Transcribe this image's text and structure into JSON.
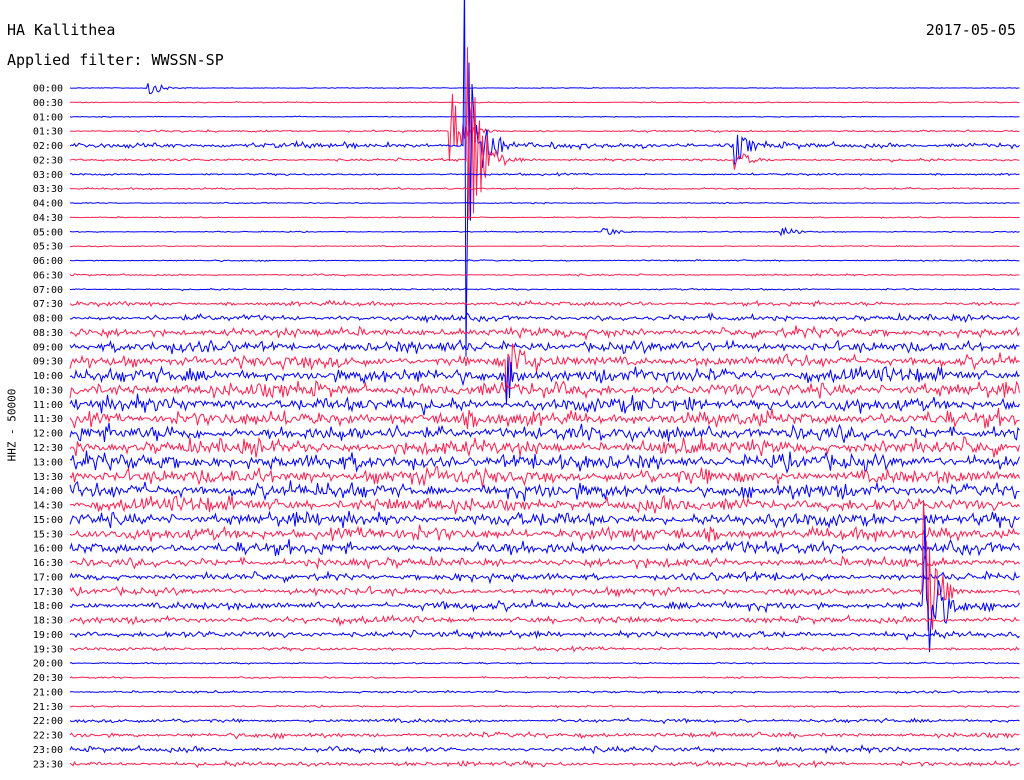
{
  "header": {
    "station": "HA Kallithea",
    "date": "2017-05-05",
    "filter": "Applied filter: WWSSN-SP"
  },
  "chart_data": {
    "type": "line",
    "title": "HA Kallithea",
    "ylabel": "HHZ - 50000",
    "colors": [
      "#0000ff",
      "#ff1f4f"
    ],
    "tick_labels": [
      "00:00",
      "00:30",
      "01:00",
      "01:30",
      "02:00",
      "02:30",
      "03:00",
      "03:30",
      "04:00",
      "04:30",
      "05:00",
      "05:30",
      "06:00",
      "06:30",
      "07:00",
      "07:30",
      "08:00",
      "08:30",
      "09:00",
      "09:30",
      "10:00",
      "10:30",
      "11:00",
      "11:30",
      "12:00",
      "12:30",
      "13:00",
      "13:30",
      "14:00",
      "14:30",
      "15:00",
      "15:30",
      "16:00",
      "16:30",
      "17:00",
      "17:30",
      "18:00",
      "18:30",
      "19:00",
      "19:30",
      "20:00",
      "20:30",
      "21:00",
      "21:30",
      "22:00",
      "22:30",
      "23:00",
      "23:30"
    ],
    "noise_level": [
      0.15,
      0.2,
      0.15,
      0.35,
      1.0,
      0.5,
      0.35,
      0.35,
      0.2,
      0.2,
      0.2,
      0.2,
      0.25,
      0.3,
      0.3,
      0.8,
      1.1,
      1.7,
      2.0,
      2.2,
      2.5,
      2.7,
      2.7,
      2.7,
      2.8,
      2.8,
      2.8,
      2.8,
      2.7,
      2.6,
      2.5,
      2.4,
      2.2,
      1.7,
      1.4,
      1.3,
      1.5,
      1.2,
      1.3,
      0.6,
      0.3,
      0.3,
      0.4,
      0.3,
      0.7,
      0.9,
      1.0,
      0.9
    ],
    "events": [
      {
        "row": 0,
        "minute": 2.5,
        "amplitude": 9
      },
      {
        "row": 3,
        "minute": 12.0,
        "amplitude": 50
      },
      {
        "row": 4,
        "minute": 12.5,
        "amplitude": 220
      },
      {
        "row": 5,
        "minute": 12.6,
        "amplitude": 160
      },
      {
        "row": 4,
        "minute": 21.0,
        "amplitude": 20
      },
      {
        "row": 5,
        "minute": 21.0,
        "amplitude": 14
      },
      {
        "row": 10,
        "minute": 16.8,
        "amplitude": 8
      },
      {
        "row": 10,
        "minute": 22.5,
        "amplitude": 7
      },
      {
        "row": 19,
        "minute": 13.8,
        "amplitude": 40
      },
      {
        "row": 20,
        "minute": 13.8,
        "amplitude": 25
      },
      {
        "row": 35,
        "minute": 27.0,
        "amplitude": 90
      },
      {
        "row": 36,
        "minute": 27.0,
        "amplitude": 100
      }
    ]
  }
}
